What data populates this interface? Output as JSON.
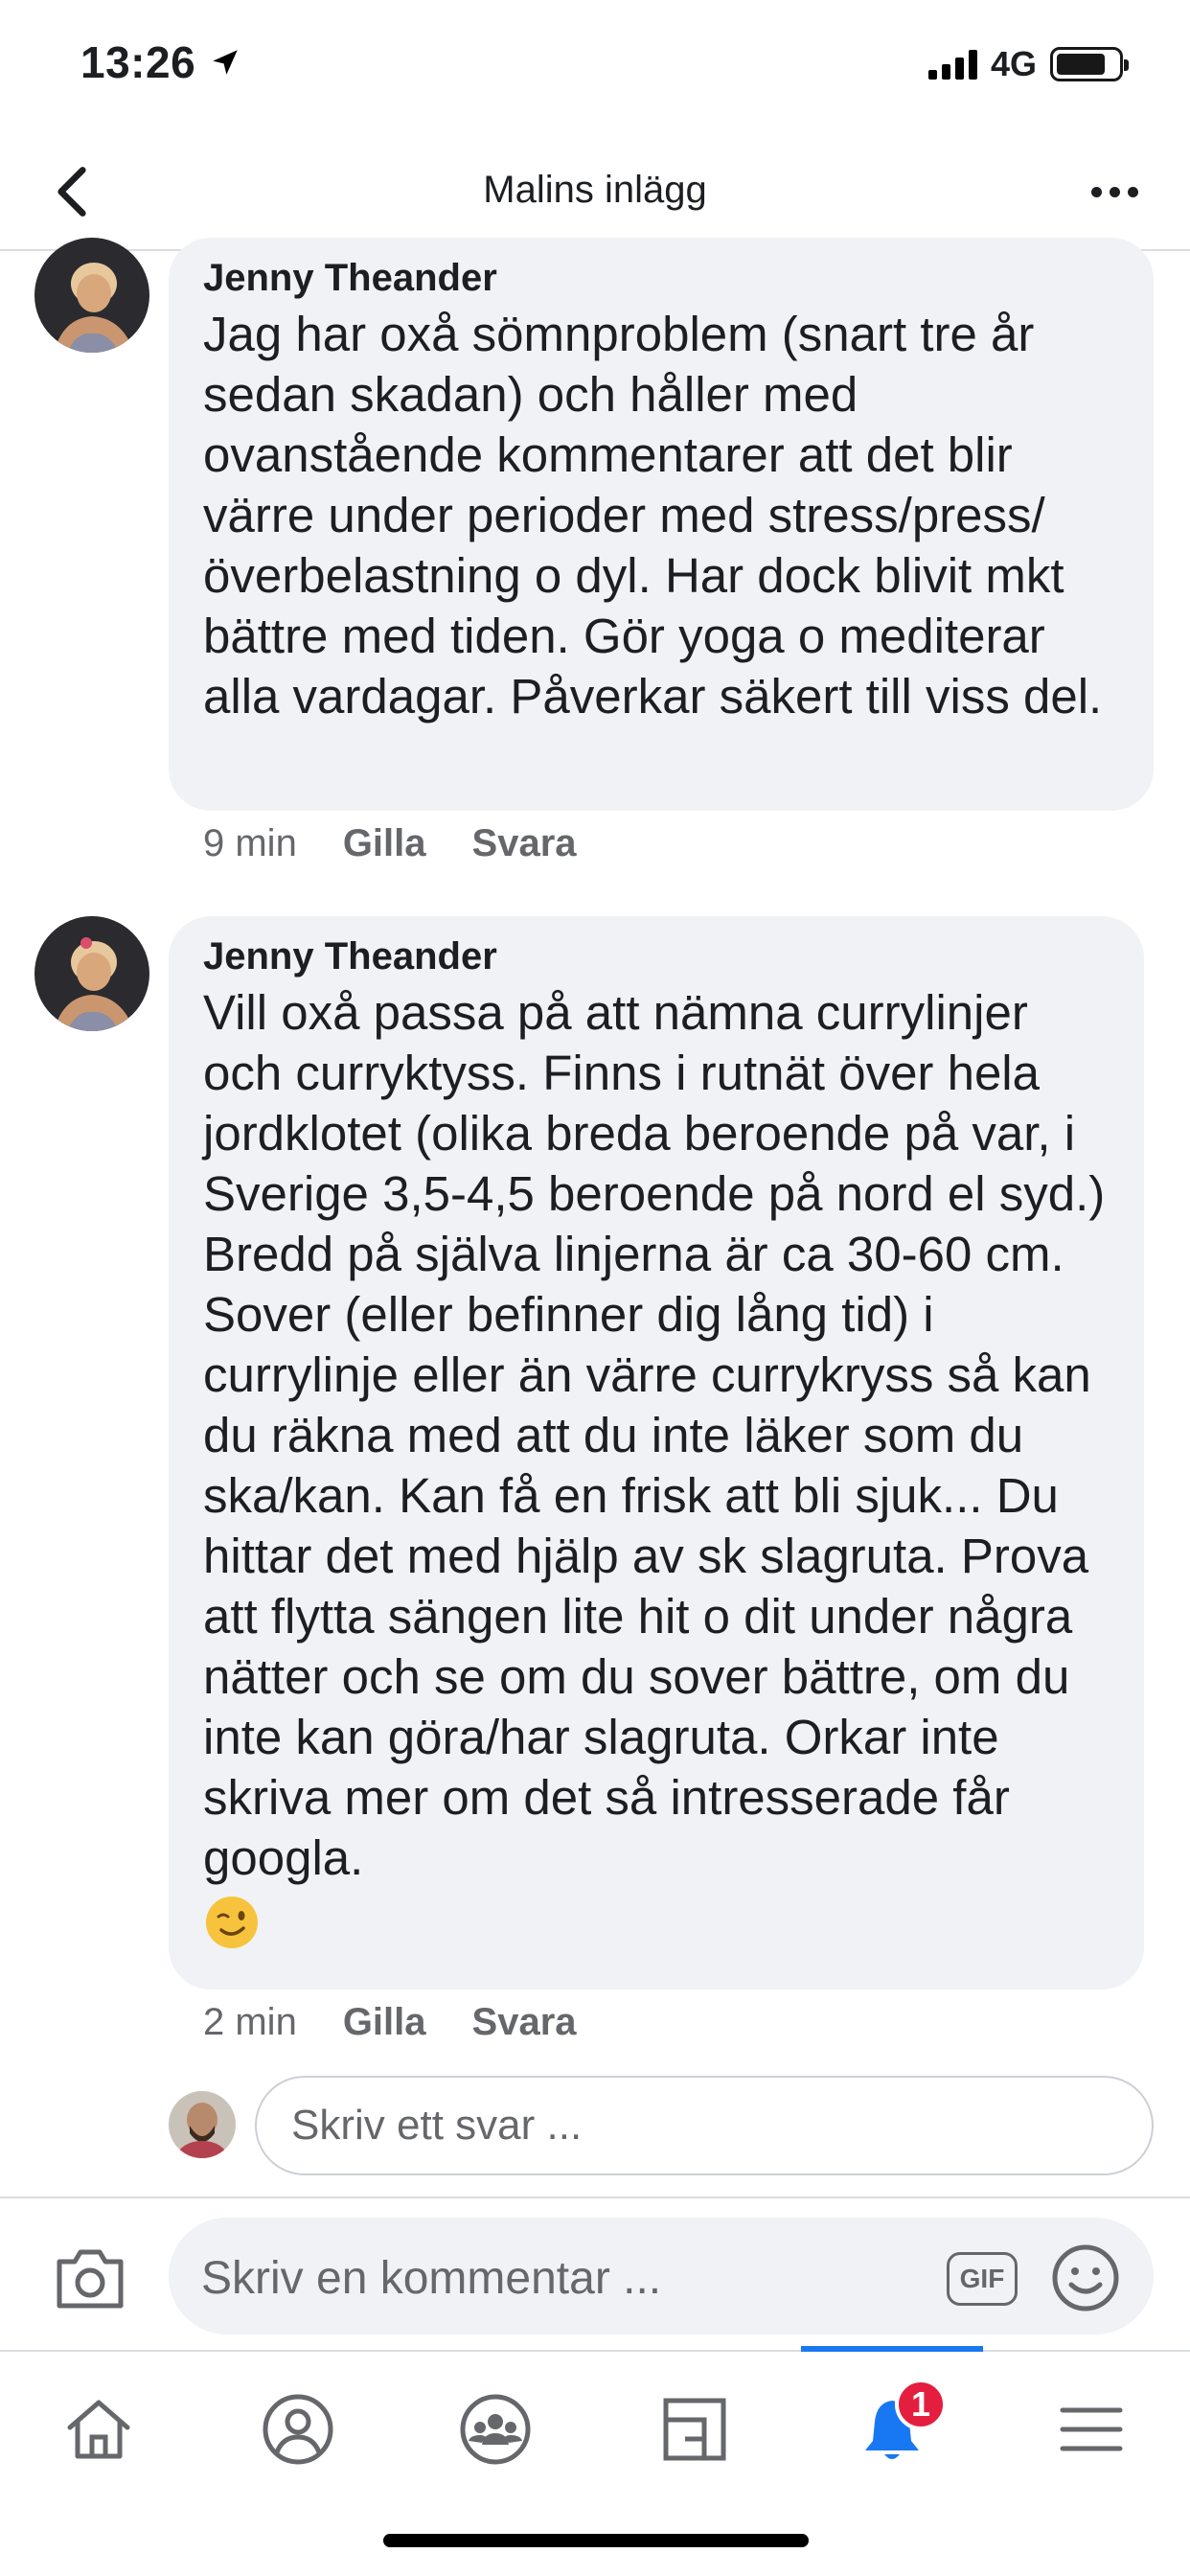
{
  "status": {
    "time": "13:26",
    "network": "4G"
  },
  "header": {
    "title": "Malins inlägg"
  },
  "comments": [
    {
      "author": "Jenny Theander",
      "text": "Jag har oxå sömnproblem (snart tre år sedan skadan) och håller med ovanstående kommentarer att det blir värre under perioder med stress/press/ överbelastning o dyl. Har dock blivit mkt bättre med tiden. Gör yoga o mediterar alla vardagar. Påverkar säkert till viss del.",
      "time": "9 min",
      "like_label": "Gilla",
      "reply_label": "Svara"
    },
    {
      "author": "Jenny Theander",
      "text": "Vill oxå passa på att nämna currylinjer och curryktyss. Finns i rutnät över hela jordklotet (olika breda beroende på var, i Sverige 3,5-4,5 beroende på nord el syd.) Bredd på själva linjerna är ca 30-60 cm. Sover (eller befinner dig lång tid) i currylinje eller än värre currykryss så kan du räkna med att du inte läker som du ska/kan. Kan få en frisk att bli sjuk... Du hittar det med hjälp av sk slagruta. Prova att flytta sängen lite hit o dit under några nätter och se om du sover bättre, om du inte kan göra/har slagruta. Orkar inte skriva mer om det så intresserade får googla.",
      "emoji": "winking-face",
      "time": "2 min",
      "like_label": "Gilla",
      "reply_label": "Svara"
    }
  ],
  "reply_box": {
    "placeholder": "Skriv ett svar ..."
  },
  "composer": {
    "placeholder": "Skriv en kommentar ...",
    "gif_label": "GIF"
  },
  "tabbar": {
    "active": "notifications",
    "notification_count": "1",
    "accent_color": "#1877f2"
  }
}
